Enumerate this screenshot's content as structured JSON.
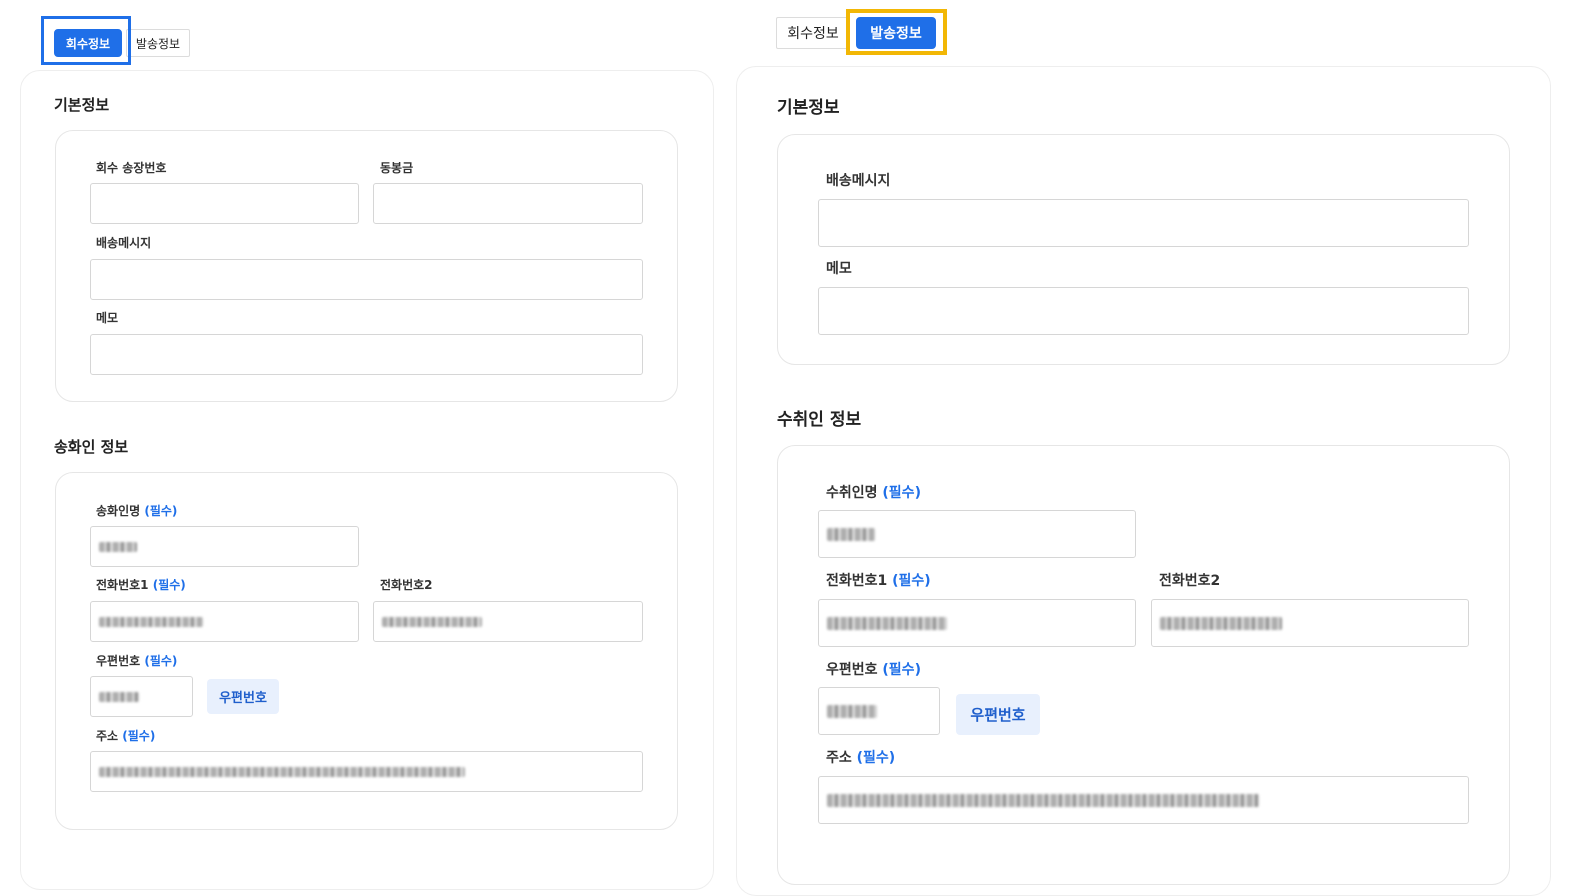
{
  "tabs": {
    "return_info": "회수정보",
    "send_info": "발송정보"
  },
  "left": {
    "basic_title": "기본정보",
    "fields": {
      "return_tracking": "회수 송장번호",
      "enclosed": "동봉금",
      "delivery_message": "배송메시지",
      "memo": "메모"
    },
    "sender_title": "송화인 정보",
    "sender": {
      "name": "송화인명",
      "phone1": "전화번호1",
      "phone2": "전화번호2",
      "zipcode": "우편번호",
      "address": "주소",
      "required": "(필수)",
      "zip_button": "우편번호"
    }
  },
  "right": {
    "basic_title": "기본정보",
    "fields": {
      "delivery_message": "배송메시지",
      "memo": "메모"
    },
    "recipient_title": "수취인 정보",
    "recipient": {
      "name": "수취인명",
      "phone1": "전화번호1",
      "phone2": "전화번호2",
      "zipcode": "우편번호",
      "address": "주소",
      "required": "(필수)",
      "zip_button": "우편번호"
    }
  },
  "colors": {
    "accent": "#1f6fe8",
    "highlight_left": "#1f6fe8",
    "highlight_right": "#f2b705"
  }
}
